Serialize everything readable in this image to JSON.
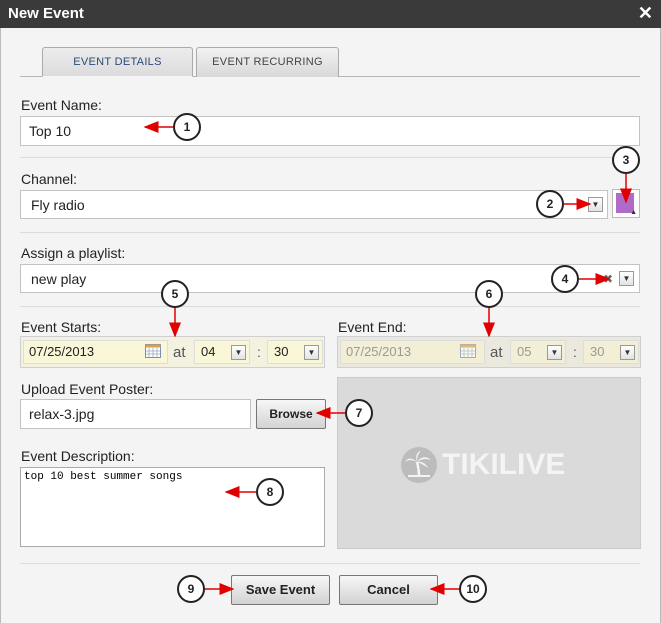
{
  "window": {
    "title": "New Event",
    "close_glyph": "✕"
  },
  "tabs": [
    {
      "label": "EVENT DETAILS",
      "active": true
    },
    {
      "label": "EVENT RECURRING",
      "active": false
    }
  ],
  "event_name": {
    "label": "Event Name:",
    "value": "Top 10"
  },
  "channel": {
    "label": "Channel:",
    "value": "Fly radio",
    "color": "#b06bc8"
  },
  "playlist": {
    "label": "Assign a playlist:",
    "value": "new play"
  },
  "event_starts": {
    "label": "Event Starts:",
    "date": "07/25/2013",
    "at": "at",
    "hour": "04",
    "minute": "30"
  },
  "event_end": {
    "label": "Event End:",
    "date": "07/25/2013",
    "at": "at",
    "hour": "05",
    "minute": "30"
  },
  "poster": {
    "label": "Upload Event Poster:",
    "filename": "relax-3.jpg",
    "browse_label": "Browse",
    "logo_text": "TIKILIVE"
  },
  "description": {
    "label": "Event Description:",
    "value": "top 10 best summer songs"
  },
  "buttons": {
    "save": "Save Event",
    "cancel": "Cancel"
  },
  "callouts": [
    "1",
    "2",
    "3",
    "4",
    "5",
    "6",
    "7",
    "8",
    "9",
    "10"
  ],
  "colors": {
    "titlebar": "#3a3a3a",
    "arrow": "#e00000"
  }
}
